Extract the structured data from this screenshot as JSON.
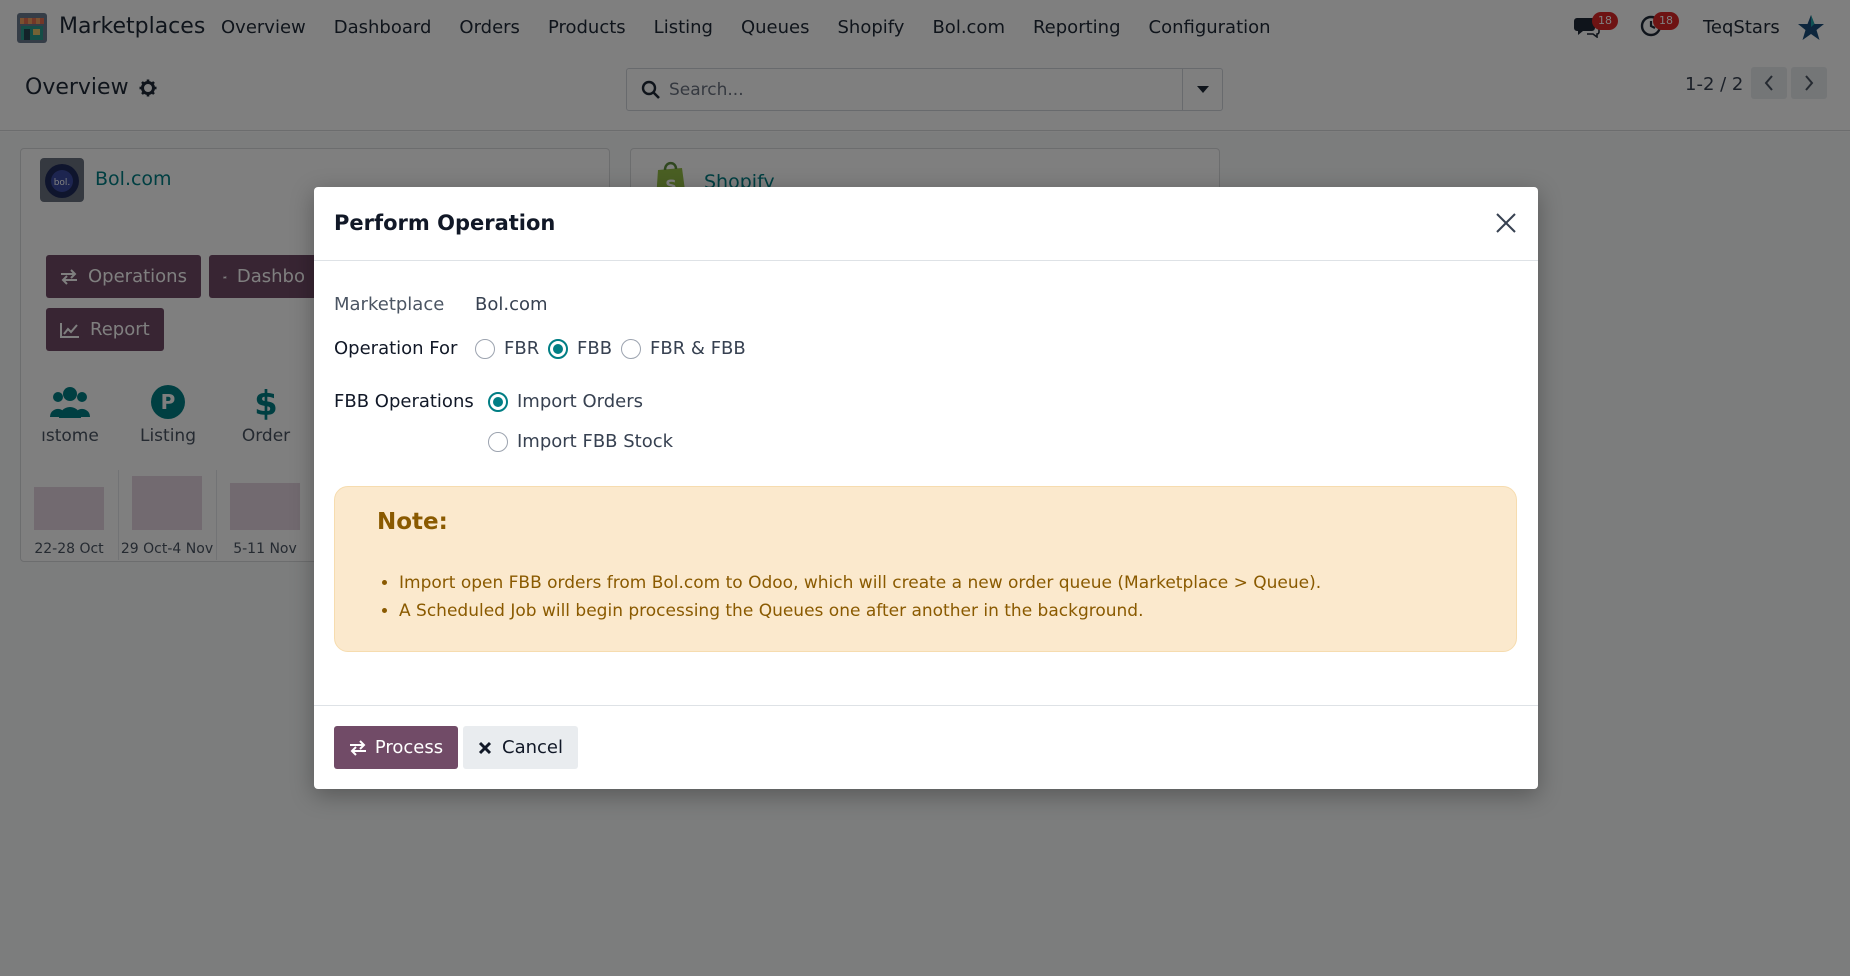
{
  "navbar": {
    "app_name": "Marketplaces",
    "menu": [
      "Overview",
      "Dashboard",
      "Orders",
      "Products",
      "Listing",
      "Queues",
      "Shopify",
      "Bol.com",
      "Reporting",
      "Configuration"
    ],
    "messages_count": "18",
    "activities_count": "18",
    "company": "TeqStars"
  },
  "control_panel": {
    "breadcrumb": "Overview",
    "search_placeholder": "Search...",
    "pager": "1-2 / 2"
  },
  "cards": {
    "bol": {
      "title": "Bol.com",
      "buttons": {
        "operations": "Operations",
        "dashboard": "Dashbo",
        "report": "Report"
      },
      "stats": {
        "customers": "ıstome",
        "listing": "Listing",
        "order": "Order"
      },
      "mini_chart": {
        "labels": [
          "22-28 Oct",
          "29 Oct-4 Nov",
          "5-11 Nov"
        ],
        "values": [
          0.72,
          0.9,
          0.78
        ]
      }
    },
    "shopify": {
      "title": "Shopify"
    }
  },
  "modal": {
    "title": "Perform Operation",
    "marketplace_label": "Marketplace",
    "marketplace_value": "Bol.com",
    "operation_for_label": "Operation For",
    "operation_for_options": [
      "FBR",
      "FBB",
      "FBR & FBB"
    ],
    "operation_for_selected": "FBB",
    "fbb_operations_label": "FBB Operations",
    "fbb_operations_options": [
      "Import Orders",
      "Import FBB Stock"
    ],
    "fbb_operations_selected": "Import Orders",
    "note_title": "Note:",
    "note_items": [
      "Import open FBB orders from Bol.com to Odoo, which will create a new order queue (Marketplace > Queue).",
      "A Scheduled Job will begin processing the Queues one after another in the background."
    ],
    "process_label": "Process",
    "cancel_label": "Cancel"
  },
  "colors": {
    "primary": "#714b67",
    "accent": "#017e84",
    "note_bg": "#fbe9cd",
    "note_text": "#8a5a00"
  }
}
